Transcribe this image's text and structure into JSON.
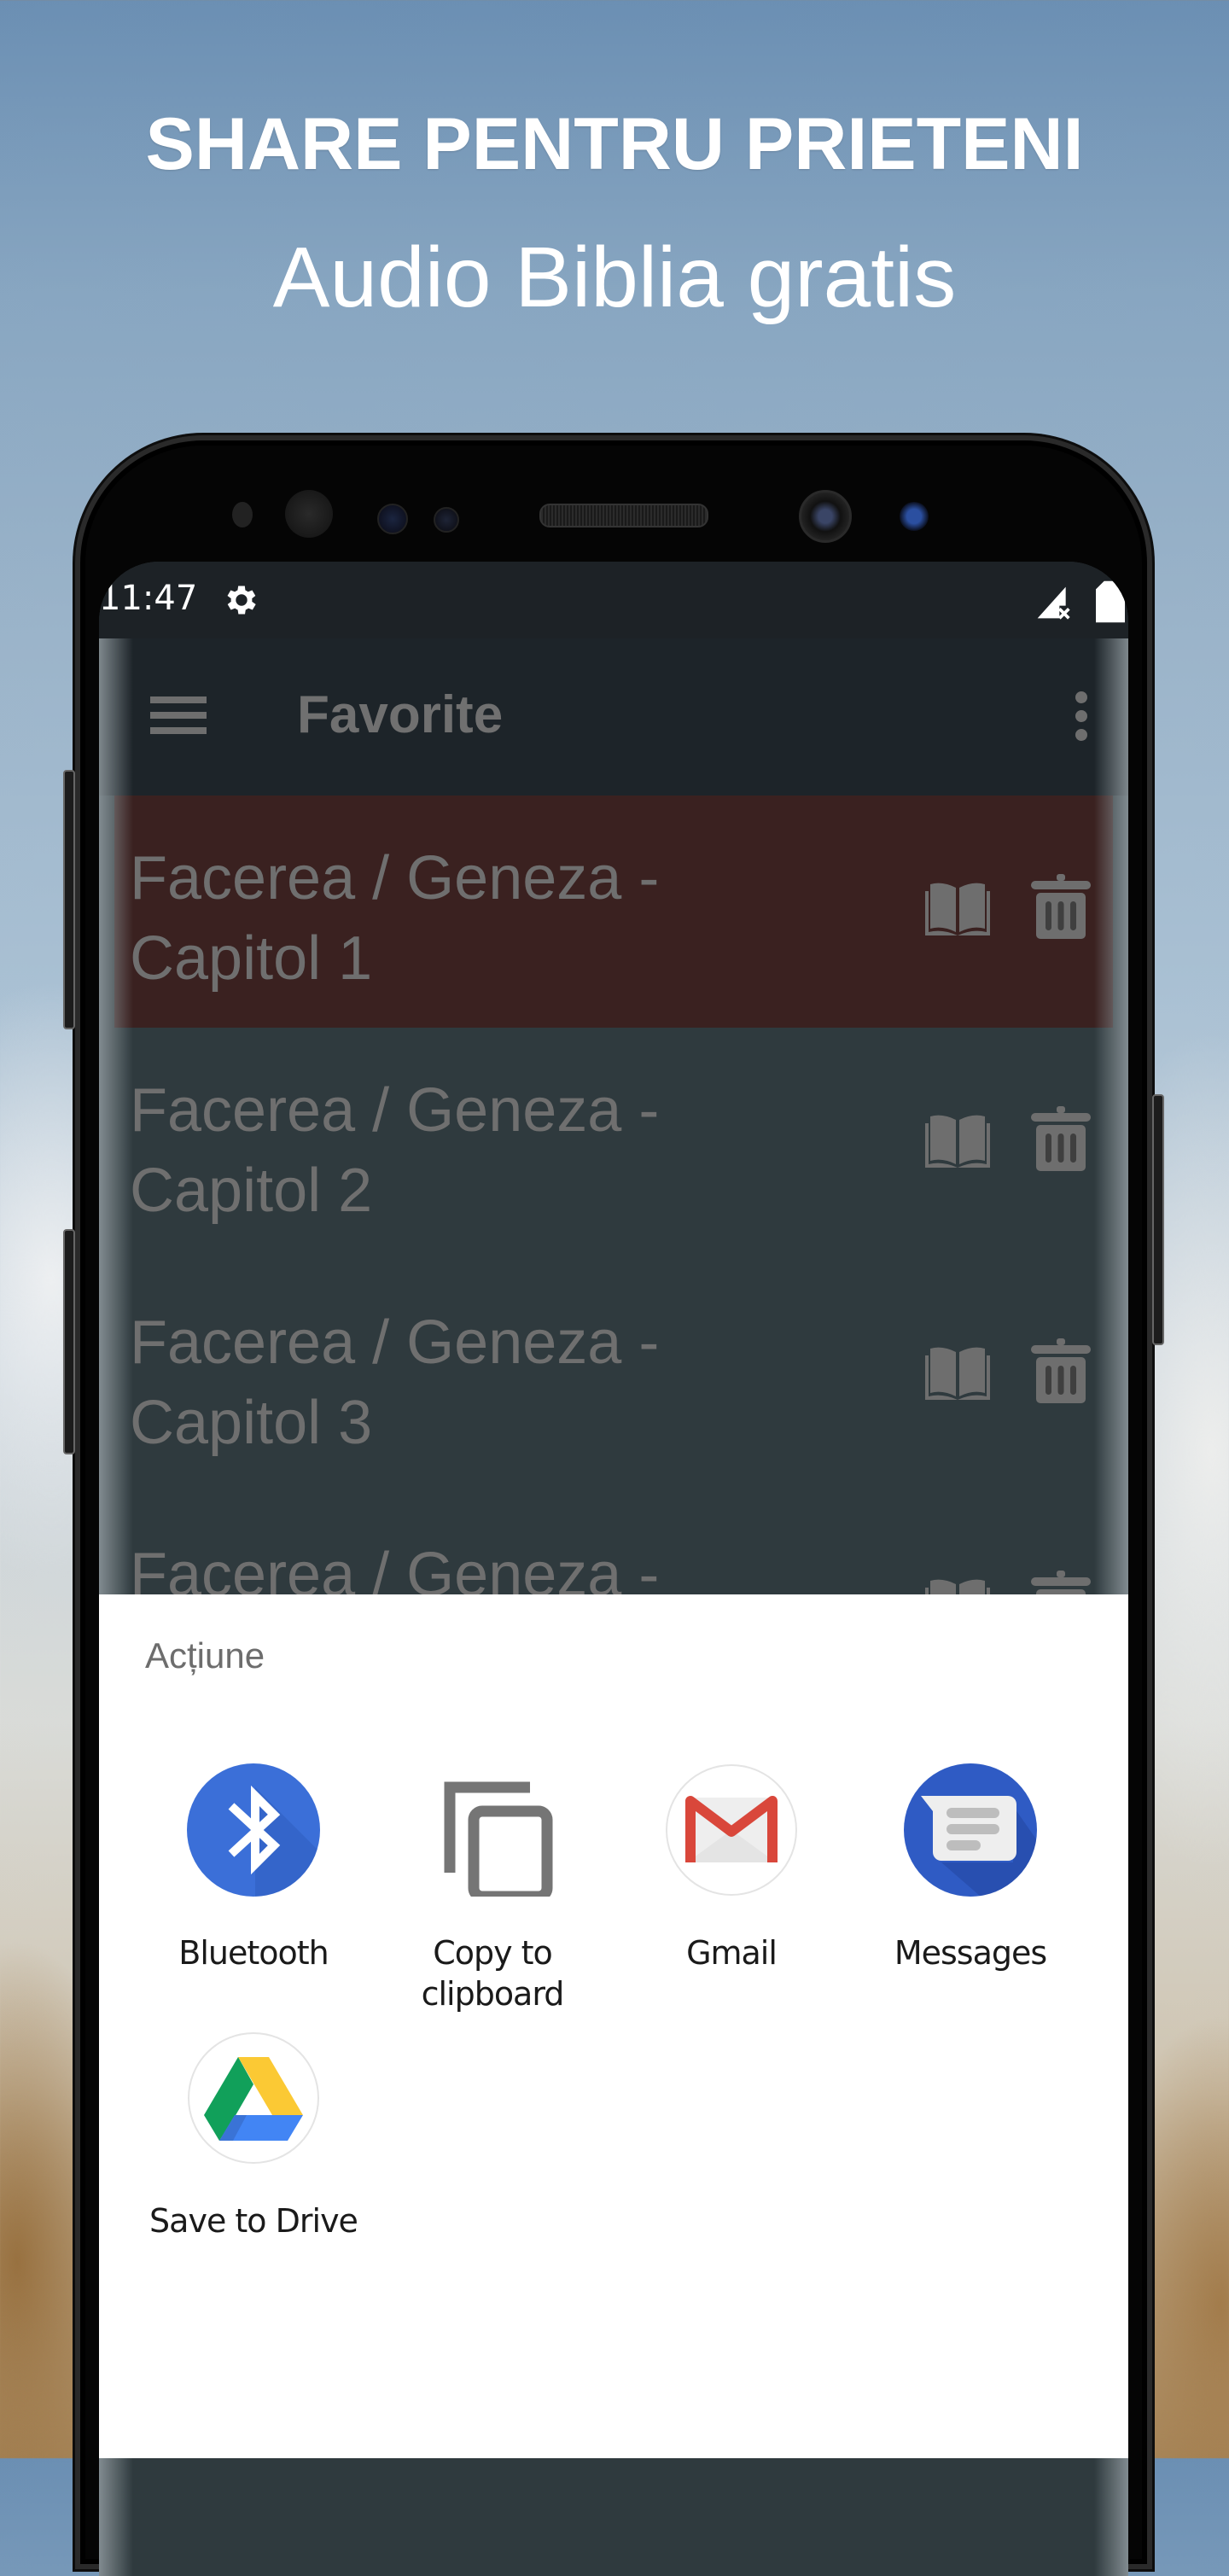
{
  "promo": {
    "headline": "SHARE PENTRU PRIETENI",
    "subline": "Audio Biblia gratis"
  },
  "status_bar": {
    "time": "11:47",
    "icons": [
      "gear-icon",
      "signal-no-service-icon",
      "battery-icon"
    ]
  },
  "app_bar": {
    "title": "Favorite",
    "menu_icon": "hamburger-menu-icon",
    "overflow_icon": "more-vert-icon"
  },
  "favorites": [
    {
      "line1": "Facerea / Geneza -",
      "line2": "Capitol 1",
      "selected": true
    },
    {
      "line1": "Facerea / Geneza -",
      "line2": "Capitol 2",
      "selected": false
    },
    {
      "line1": "Facerea / Geneza -",
      "line2": "Capitol 3",
      "selected": false
    },
    {
      "line1": "Facerea / Geneza -",
      "line2": "",
      "selected": false
    }
  ],
  "row_actions": {
    "open_icon": "open-book-icon",
    "delete_icon": "trash-icon"
  },
  "colors": {
    "selected_row": "#3a2120",
    "row": "#2f3a3e",
    "app_bar": "#1d2429",
    "bluetooth": "#3b6fd8",
    "messages": "#2f5bc4",
    "gmail_red": "#db4437"
  },
  "share_sheet": {
    "title": "Acțiune",
    "targets": [
      {
        "label": "Bluetooth",
        "icon": "bluetooth-icon"
      },
      {
        "label": "Copy to\nclipboard",
        "icon": "copy-icon"
      },
      {
        "label": "Gmail",
        "icon": "gmail-icon"
      },
      {
        "label": "Messages",
        "icon": "messages-icon"
      },
      {
        "label": "Save to Drive",
        "icon": "google-drive-icon"
      }
    ]
  }
}
